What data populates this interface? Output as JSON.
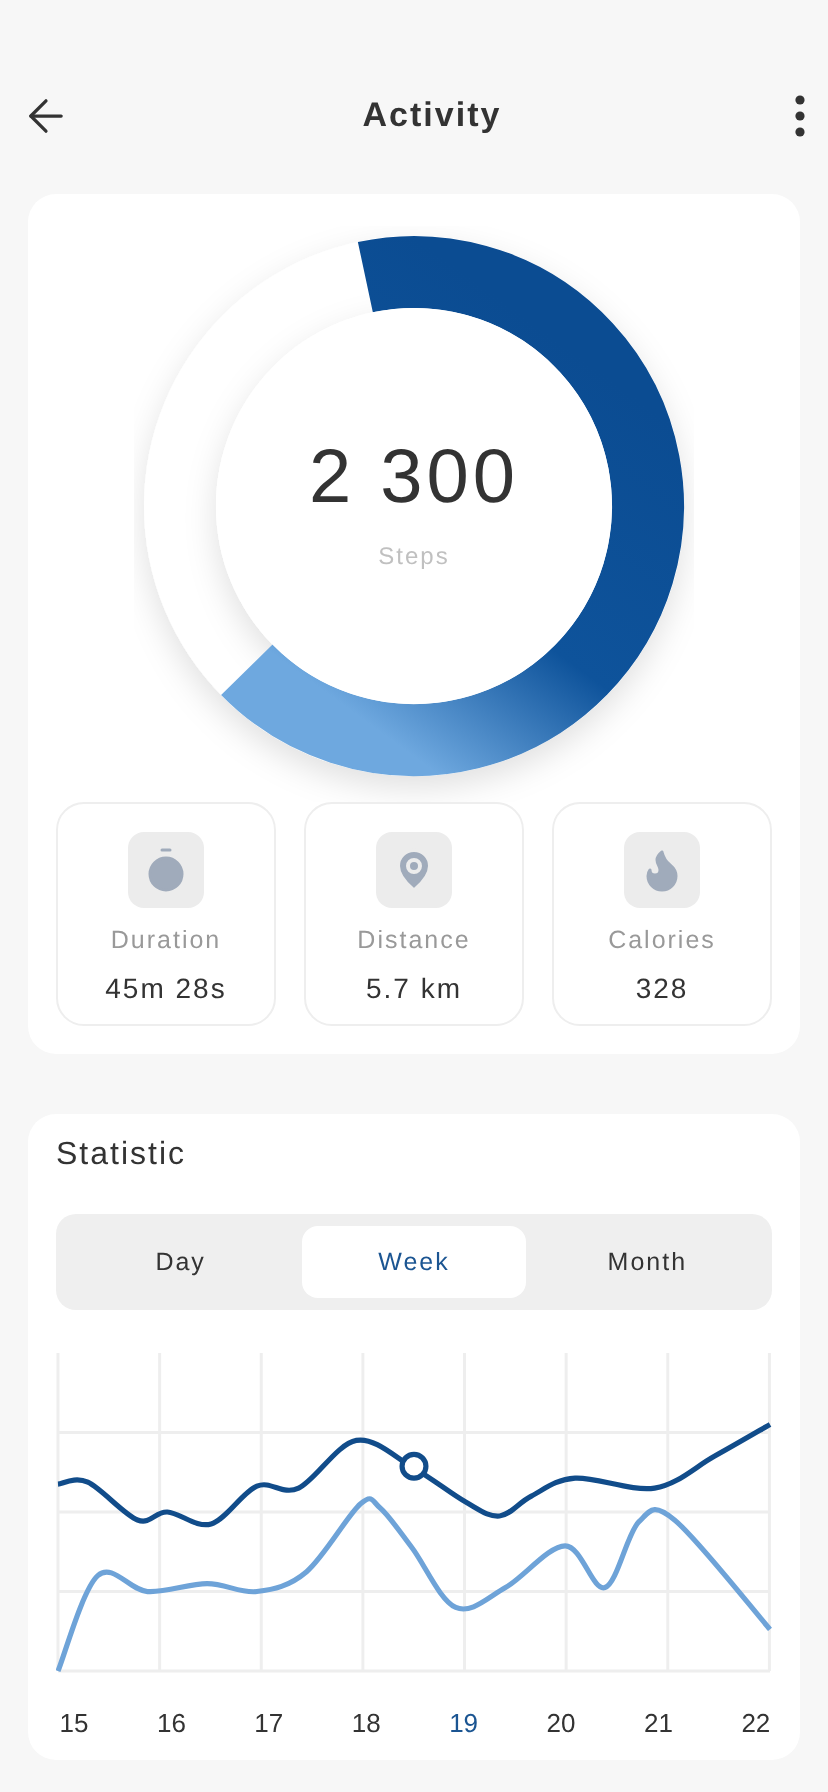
{
  "header": {
    "title": "Activity"
  },
  "progress": {
    "value": "2 300",
    "label": "Steps"
  },
  "stats": [
    {
      "kind": "duration",
      "label": "Duration",
      "value": "45m 28s"
    },
    {
      "kind": "distance",
      "label": "Distance",
      "value": "5.7 km"
    },
    {
      "kind": "calories",
      "label": "Calories",
      "value": "328"
    }
  ],
  "statistic": {
    "title": "Statistic",
    "tabs": [
      {
        "label": "Day",
        "selected": false
      },
      {
        "label": "Week",
        "selected": true
      },
      {
        "label": "Month",
        "selected": false
      }
    ],
    "x_labels": [
      {
        "label": "15",
        "selected": false
      },
      {
        "label": "16",
        "selected": false
      },
      {
        "label": "17",
        "selected": false
      },
      {
        "label": "18",
        "selected": false
      },
      {
        "label": "19",
        "selected": true
      },
      {
        "label": "20",
        "selected": false
      },
      {
        "label": "21",
        "selected": false
      },
      {
        "label": "22",
        "selected": false
      }
    ]
  }
}
